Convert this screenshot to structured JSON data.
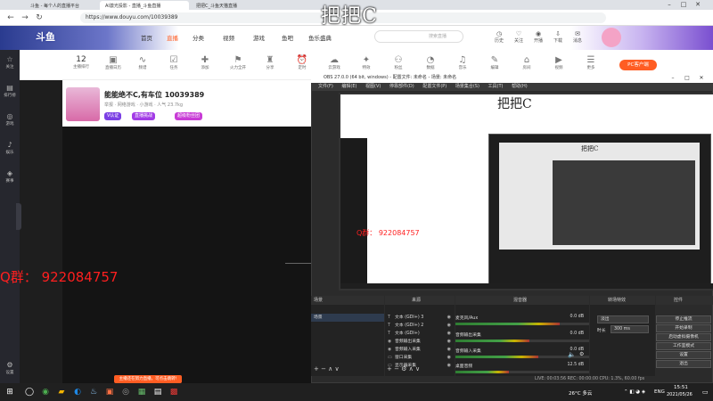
{
  "browser": {
    "tabs": [
      {
        "label": "斗鱼 - 每个人的直播平台",
        "active": false
      },
      {
        "label": "AI激光投影 - 直播_斗鱼直播",
        "active": true
      },
      {
        "label": "把把C_斗鱼天猫直播",
        "active": false
      }
    ],
    "url": "https://www.douyu.com/10039389"
  },
  "overlay_title": "把把C",
  "douyu": {
    "logo": "斗鱼",
    "nav": [
      "首页",
      "直播",
      "分类",
      "视频",
      "游戏",
      "鱼吧",
      "鱼乐盛典"
    ],
    "active_nav": "直播",
    "search_placeholder": "搜索直播",
    "header_icons": [
      "历史",
      "关注",
      "开播",
      "下载",
      "消息",
      "用户"
    ],
    "categories": [
      {
        "count": "12",
        "label": "主播排行"
      },
      {
        "icon": "▣",
        "label": "直播日历"
      },
      {
        "icon": "∿",
        "label": "频谱"
      },
      {
        "icon": "☑",
        "label": "任务"
      },
      {
        "icon": "✚",
        "label": "添加"
      },
      {
        "icon": "⚑",
        "label": "火力全开"
      },
      {
        "icon": "♜",
        "label": "分享"
      },
      {
        "icon": "⏰",
        "label": "定时"
      },
      {
        "icon": "☁",
        "label": "云游戏"
      },
      {
        "icon": "✦",
        "label": "特效"
      },
      {
        "icon": "⚇",
        "label": "粉丝"
      },
      {
        "icon": "◔",
        "label": "数据"
      },
      {
        "icon": "♫",
        "label": "音乐"
      },
      {
        "icon": "✎",
        "label": "编辑"
      },
      {
        "icon": "⌂",
        "label": "房间"
      },
      {
        "icon": "▶",
        "label": "视频"
      },
      {
        "icon": "☰",
        "label": "更多"
      }
    ],
    "pc_button": "PC客户端",
    "streamer": {
      "title": "能能绝不C,有车位 10039389",
      "meta": "举报  · 网络游戏 · 小游戏  · 人气 23.7kg",
      "badges": [
        "V认证",
        "直播挑战",
        "超级粉丝团"
      ]
    },
    "qq_text": "Q群：  922084757",
    "promo_text": "主播还在努力直播，可点击跳转!"
  },
  "sidebar": [
    {
      "icon": "☆",
      "label": "关注"
    },
    {
      "icon": "▤",
      "label": "排行榜"
    },
    {
      "icon": "◎",
      "label": "游戏"
    },
    {
      "icon": "♪",
      "label": "娱乐"
    },
    {
      "icon": "◈",
      "label": "赛事"
    },
    {
      "icon": "⚙",
      "label": "设置"
    }
  ],
  "obs": {
    "title": "OBS 27.0.0 (64 bit, windows) - 配置文件: 未命名 - 场景: 未命名",
    "menu": [
      "文件(F)",
      "编辑(E)",
      "视图(V)",
      "停靠部件(D)",
      "配置文件(P)",
      "场景集合(S)",
      "工具(T)",
      "帮助(H)"
    ],
    "preview_title": "把把C",
    "preview_qq": "Q群：  922084757",
    "docks": {
      "scenes_title": "场景",
      "scene_item": "场景",
      "sources_title": "来源",
      "mixer_title": "混音器",
      "transitions_title": "转场特效",
      "controls_title": "控件"
    },
    "sources": [
      {
        "icon": "T",
        "label": "文本 (GDI+) 3"
      },
      {
        "icon": "T",
        "label": "文本 (GDI+) 2"
      },
      {
        "icon": "T",
        "label": "文本 (GDI+)"
      },
      {
        "icon": "◉",
        "label": "音频输出采集"
      },
      {
        "icon": "◉",
        "label": "音频输入采集"
      },
      {
        "icon": "▭",
        "label": "窗口采集"
      },
      {
        "icon": "▭",
        "label": "显示器采集"
      }
    ],
    "mixer": [
      {
        "name": "麦克风/Aux",
        "db": "0.0 dB",
        "level": 0.78
      },
      {
        "name": "音频输出采集",
        "db": "0.0 dB",
        "level": 0.55
      },
      {
        "name": "音频输入采集",
        "db": "0.0 dB",
        "level": 0.62
      },
      {
        "name": "桌面音频",
        "db": "12.5 dB",
        "level": 0.4
      }
    ],
    "transition": {
      "type": "淡出",
      "duration_label": "时长",
      "duration": "300 ms"
    },
    "controls": [
      "停止推流",
      "开始录制",
      "启动虚拟摄像机",
      "工作室模式",
      "设置",
      "退出"
    ],
    "status": "LIVE: 00:03:56   REC: 00:00:00   CPU: 1.3%, 60.00 fps"
  },
  "taskbar": {
    "weather": "26°C 多云",
    "time": "15:51",
    "date": "2021/05/26",
    "lang": "ENG"
  }
}
